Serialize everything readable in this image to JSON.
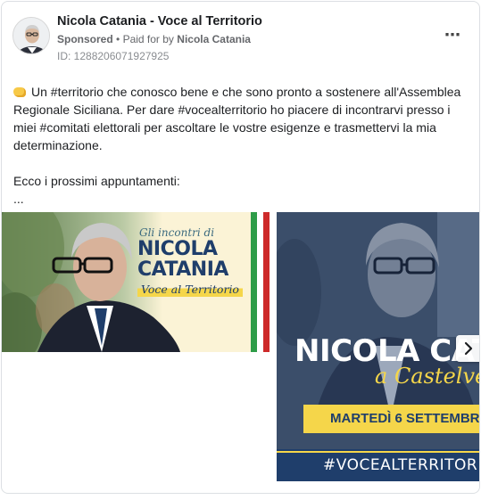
{
  "ad": {
    "page_name": "Nicola Catania - Voce al Territorio",
    "sponsored": "Sponsored",
    "separator": "•",
    "paid_for_by": "Paid for by",
    "payer": "Nicola Catania",
    "library_id": "ID: 1288206071927925",
    "more_icon": "more-horizontal-icon",
    "more_label": "⋯"
  },
  "post": {
    "line1": "Un #territorio che conosco bene e che sono pronto a sostenere all'Assemblea Regionale Siciliana. Per dare #vocealterritorio ho piacere di incontrarvi presso i miei #comitati elettorali per ascoltare le vostre esigenze e trasmettervi la mia determinazione.",
    "line2": "Ecco i prossimi appuntamenti:",
    "line3": "...",
    "emoji": "handshake-icon"
  },
  "carousel": {
    "slide1": {
      "subtitle": "Gli incontri di",
      "name_line1": "NICOLA",
      "name_line2": "CATANIA",
      "tagline": "Voce al Territorio"
    },
    "slide2": {
      "name": "NICOLA CATA",
      "place": "a Castelvet",
      "date": "MARTEDÌ 6 SETTEMBR",
      "hashtag": "#VOCEALTERRITOR"
    },
    "next_icon": "chevron-right-icon"
  },
  "colors": {
    "navy": "#1f3e6b",
    "yellow": "#f5d64a",
    "flag_green": "#2e9c48",
    "flag_red": "#cd2a2a"
  }
}
